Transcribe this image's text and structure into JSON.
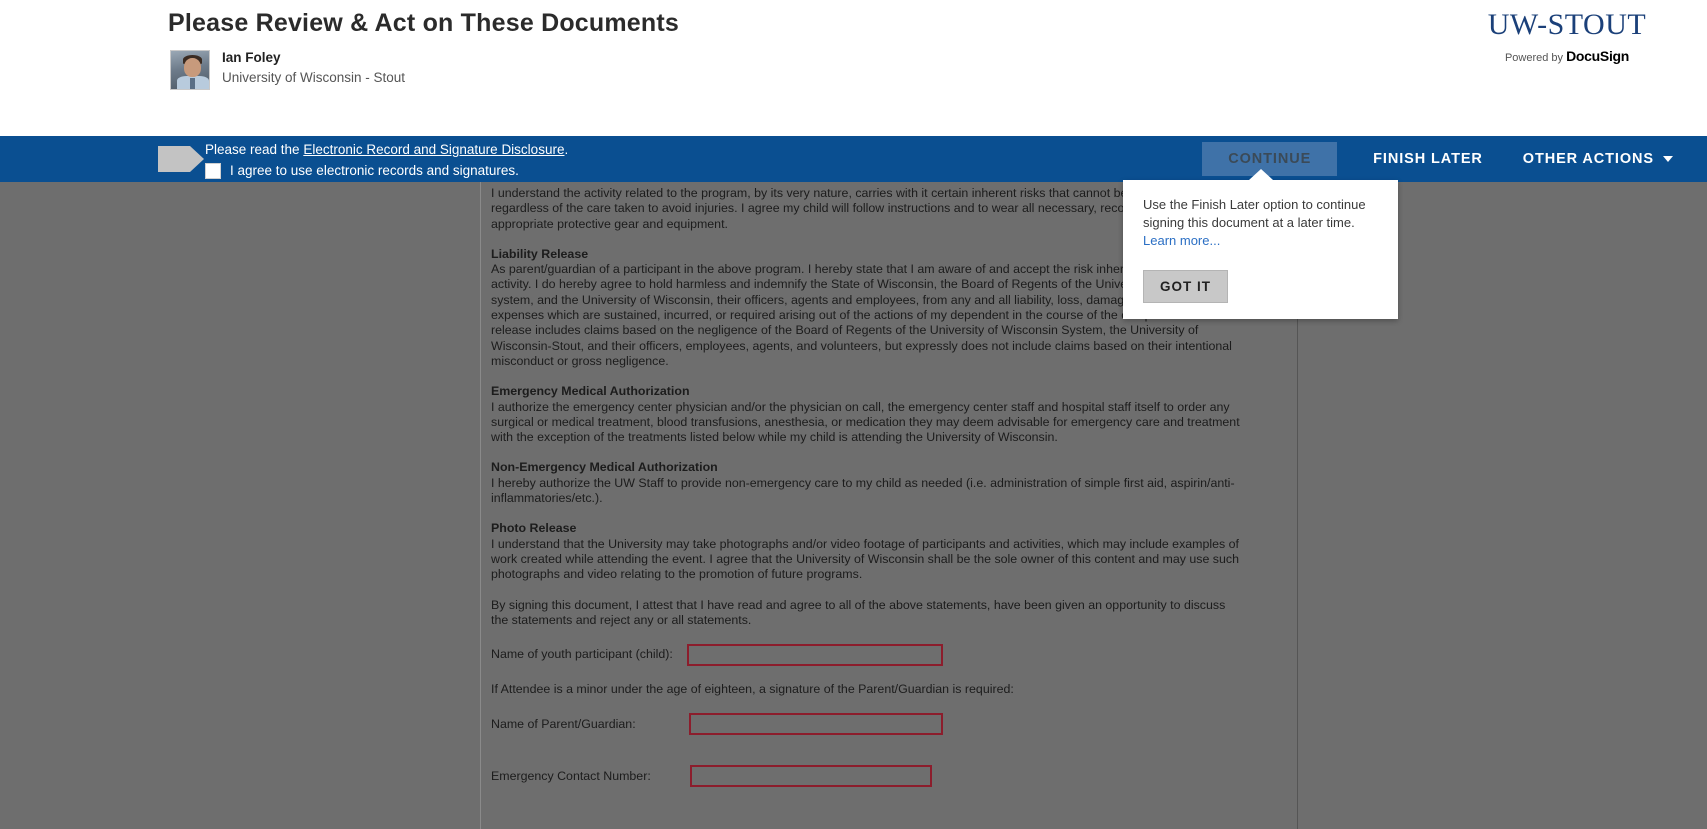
{
  "header": {
    "title": "Please Review & Act on These Documents",
    "sender_name": "Ian Foley",
    "sender_org": "University of Wisconsin - Stout",
    "brand_logo": "UW-STOUT",
    "powered_by_prefix": "Powered by ",
    "powered_by_brand": "DocuSign"
  },
  "action_bar": {
    "disclosure_prefix": "Please read the ",
    "disclosure_link": "Electronic Record and Signature Disclosure",
    "disclosure_suffix": ".",
    "agree_label": "I agree to use electronic records and signatures.",
    "continue_label": "CONTINUE",
    "finish_later_label": "FINISH LATER",
    "other_actions_label": "OTHER ACTIONS"
  },
  "tooltip": {
    "text": "Use the Finish Later option to continue signing this document at a later time. ",
    "link_label": "Learn more...",
    "button_label": "GOT IT"
  },
  "document": {
    "intro_paragraph": "I understand the activity related to the program, by its very nature, carries with it certain inherent risks that cannot be eliminated regardless of the care taken to avoid injuries.  I agree my child will follow instructions and to wear all necessary, recommended, and appropriate protective gear and equipment.",
    "liability_heading": "Liability Release",
    "liability_paragraph": "As parent/guardian of a participant in the above program. I hereby state that I am aware of and accept the risk inherent in the program activity. I do hereby agree to hold harmless and indemnify the State of Wisconsin, the Board of Regents of the University of Wisconsin system, and the University of Wisconsin, their officers, agents and employees, from any and all liability, loss, damages, costs, or expenses which are sustained, incurred, or required arising out of the actions of my dependent in the course of the camp/clinic. This release includes claims based on the negligence of the Board of Regents of the University of Wisconsin System, the University of Wisconsin-Stout, and their officers, employees, agents, and volunteers, but expressly does not include claims based on their intentional misconduct or gross negligence.",
    "emergency_heading": "Emergency Medical Authorization",
    "emergency_paragraph": "I authorize the emergency center physician and/or the physician on call, the emergency center staff and hospital staff itself to order any surgical or medical treatment, blood transfusions, anesthesia, or medication they may deem advisable for emergency care and treatment with the exception of the treatments listed below while my child is attending the University of Wisconsin.",
    "non_emergency_heading": "Non-Emergency Medical Authorization",
    "non_emergency_paragraph": "I hereby authorize the UW Staff to provide non-emergency care to my child as needed (i.e. administration of simple first aid, aspirin/anti-inflammatories/etc.).",
    "photo_heading": "Photo Release",
    "photo_paragraph": "I understand that the University may take photographs and/or video footage of participants and activities, which may include examples of work created while attending the event. I agree that the University of Wisconsin shall be the sole owner of this content and may use such photographs and video relating to the promotion of future programs.",
    "attest_paragraph": "By signing this document, I attest that I have read and agree to all of the above statements, have been given an opportunity to discuss the statements and reject any or all statements.",
    "field_youth_label": "Name of youth participant (child):",
    "minor_note": "If Attendee is a minor under the age of eighteen, a signature of the Parent/Guardian is required:",
    "field_parent_label": "Name of Parent/Guardian:",
    "field_emergency_label": "Emergency Contact Number:"
  },
  "colors": {
    "action_bar_blue": "#0a4f91",
    "brand_blue": "#1b4079",
    "field_border_red": "#8c1d2c",
    "overlay_gray": "#6e6e6e"
  }
}
